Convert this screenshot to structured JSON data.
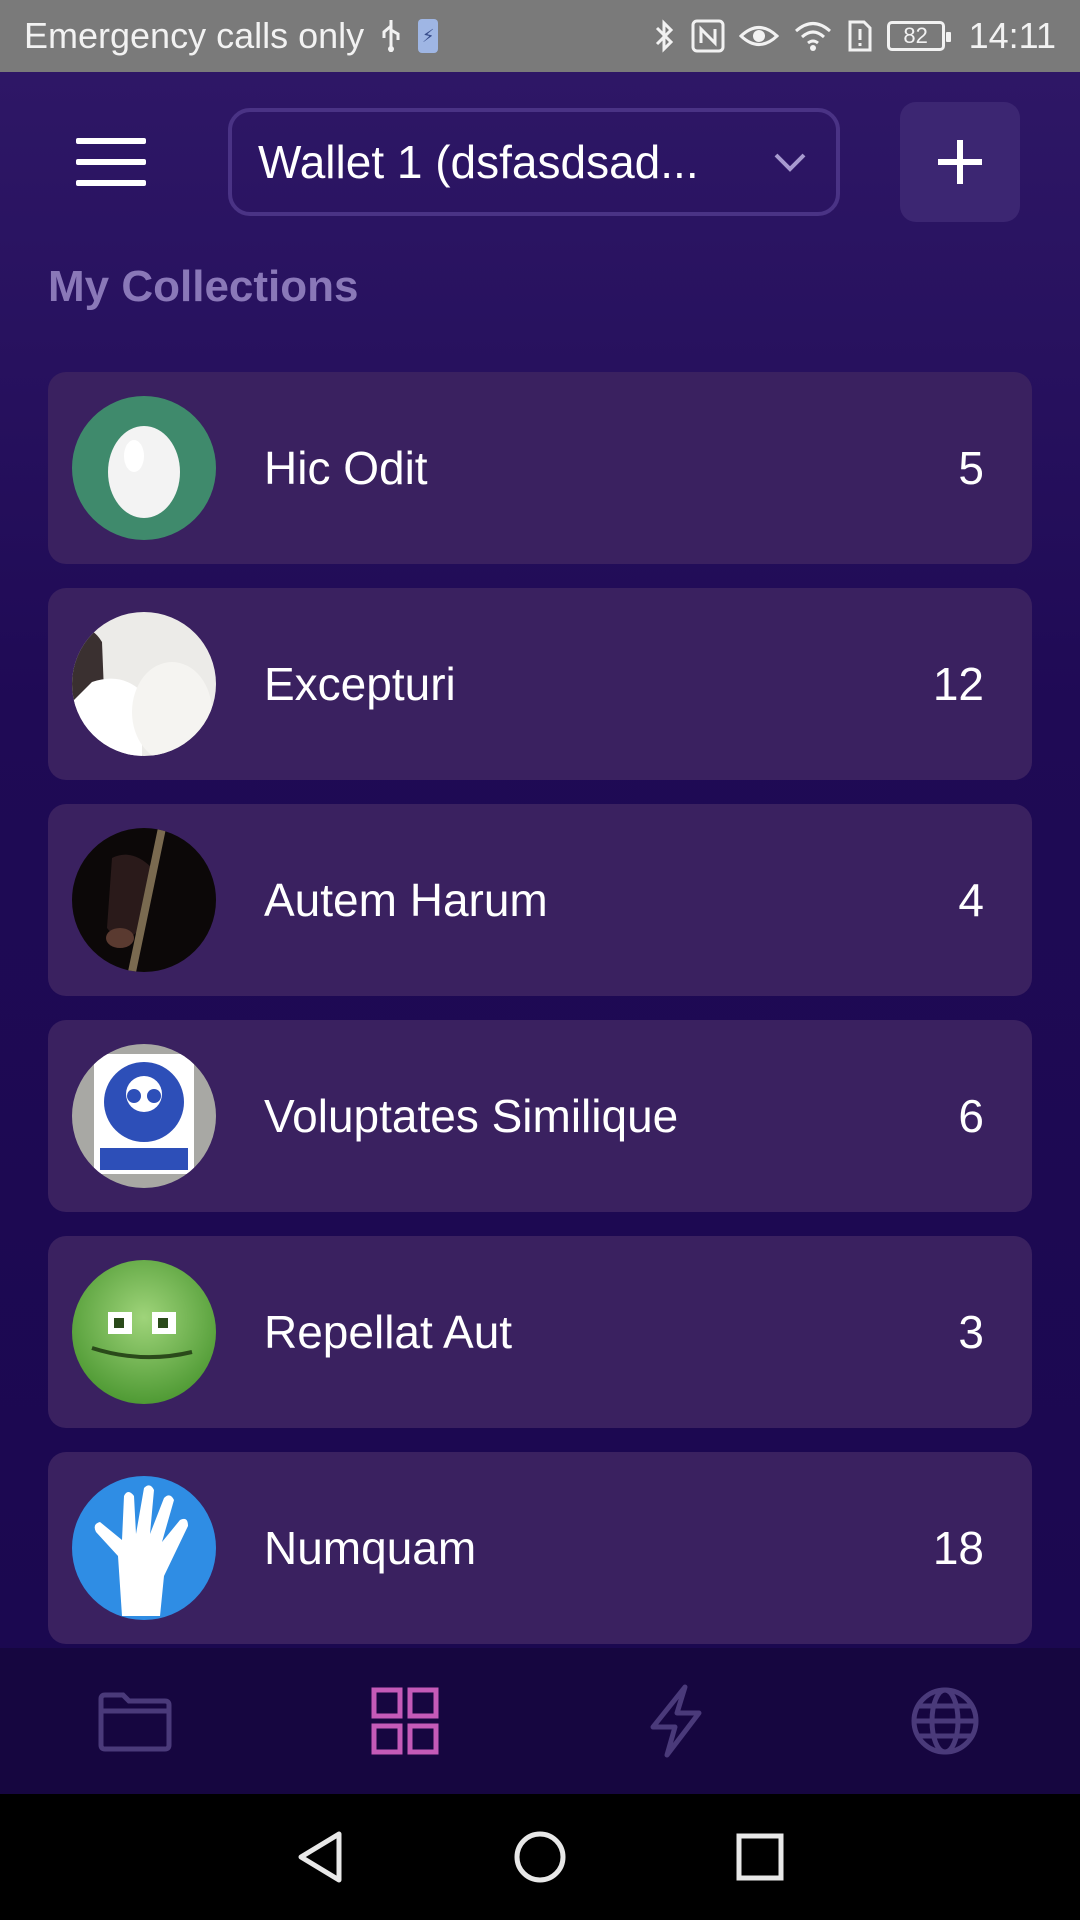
{
  "status_bar": {
    "carrier_text": "Emergency calls only",
    "battery_level": "82",
    "time": "14:11"
  },
  "header": {
    "wallet_label": "Wallet 1 (dsfasdsad...",
    "menu_icon": "hamburger-icon",
    "add_icon": "plus-icon"
  },
  "section_title": "My Collections",
  "collections": [
    {
      "name": "Hic Odit",
      "count": "5",
      "avatar": "egg-avatar"
    },
    {
      "name": "Excepturi",
      "count": "12",
      "avatar": "person-avatar"
    },
    {
      "name": "Autem Harum",
      "count": "4",
      "avatar": "guitar-avatar"
    },
    {
      "name": "Voluptates Similique",
      "count": "6",
      "avatar": "safety-sign-avatar"
    },
    {
      "name": "Repellat Aut",
      "count": "3",
      "avatar": "green-face-avatar"
    },
    {
      "name": "Numquam",
      "count": "18",
      "avatar": "hand-avatar"
    }
  ],
  "tabs": [
    {
      "icon": "folder-icon",
      "active": false
    },
    {
      "icon": "grid-icon",
      "active": true
    },
    {
      "icon": "lightning-icon",
      "active": false
    },
    {
      "icon": "globe-icon",
      "active": false
    }
  ],
  "colors": {
    "background": "#1a0842",
    "card": "#3a2160",
    "accent": "#c45ab8",
    "muted_title": "#8a78b8"
  }
}
